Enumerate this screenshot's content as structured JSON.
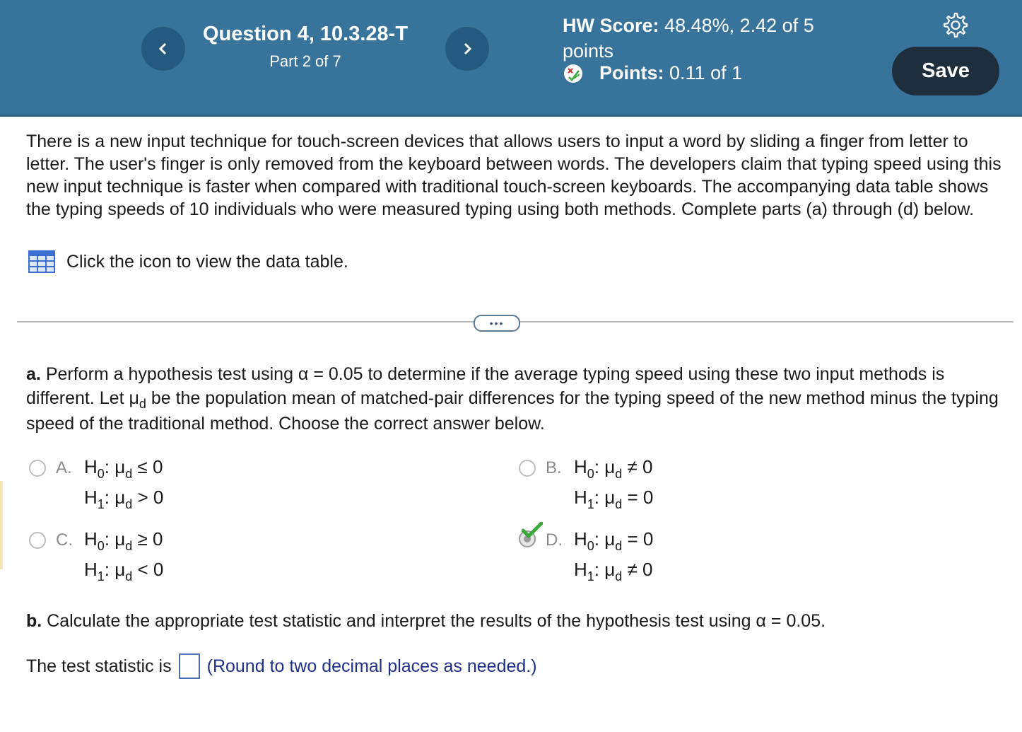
{
  "header": {
    "question_title": "Question 4, 10.3.28-T",
    "part": "Part 2 of 7",
    "hw_score_label": "HW Score:",
    "hw_score_value": "48.48%, 2.42 of 5",
    "hw_score_unit": "points",
    "points_label": "Points:",
    "points_value": "0.11 of 1",
    "save_label": "Save"
  },
  "problem": {
    "text": "There is a new input technique for touch-screen devices that allows users to input a word by sliding a finger from letter to letter. The user's finger is only removed from the keyboard between words. The developers claim that typing speed using this new input technique is faster when compared with traditional touch-screen keyboards. The accompanying data table shows the typing speeds of 10 individuals who were measured typing using both methods. Complete parts (a) through (d) below.",
    "data_link": "Click the icon to view the data table."
  },
  "divider_more": "•••",
  "part_a": {
    "label": "a.",
    "text_1": "Perform a hypothesis test using α = 0.05 to determine if the average typing speed using these two input methods is different. Let μ",
    "sub": "d",
    "text_2": " be the population mean of matched-pair differences for the typing speed of the new method minus the typing speed of the traditional method. Choose the correct answer below.",
    "options": [
      {
        "letter": "A.",
        "h0": "H",
        "h0_sub": "0",
        "h0_rel": ": μ",
        "h0_rel_sub": "d",
        "h0_tail": " ≤ 0",
        "h1": "H",
        "h1_sub": "1",
        "h1_rel": ": μ",
        "h1_rel_sub": "d",
        "h1_tail": " > 0"
      },
      {
        "letter": "B.",
        "h0": "H",
        "h0_sub": "0",
        "h0_rel": ": μ",
        "h0_rel_sub": "d",
        "h0_tail": " ≠ 0",
        "h1": "H",
        "h1_sub": "1",
        "h1_rel": ": μ",
        "h1_rel_sub": "d",
        "h1_tail": " = 0"
      },
      {
        "letter": "C.",
        "h0": "H",
        "h0_sub": "0",
        "h0_rel": ": μ",
        "h0_rel_sub": "d",
        "h0_tail": " ≥ 0",
        "h1": "H",
        "h1_sub": "1",
        "h1_rel": ": μ",
        "h1_rel_sub": "d",
        "h1_tail": " < 0"
      },
      {
        "letter": "D.",
        "h0": "H",
        "h0_sub": "0",
        "h0_rel": ": μ",
        "h0_rel_sub": "d",
        "h0_tail": " = 0",
        "h1": "H",
        "h1_sub": "1",
        "h1_rel": ": μ",
        "h1_rel_sub": "d",
        "h1_tail": " ≠ 0",
        "selected": true,
        "correct": true
      }
    ]
  },
  "part_b": {
    "label": "b.",
    "text": "Calculate the appropriate test statistic and interpret the results of the hypothesis test using α = 0.05.",
    "ts_label": "The test statistic is",
    "ts_value": "",
    "ts_hint": "(Round to two decimal places as needed.)"
  },
  "colors": {
    "header_bg": "#37739a",
    "nav_btn": "#245a7e",
    "save_btn": "#1e2e3c",
    "hint_text": "#1d2f8a",
    "correct_check": "#3aa83a"
  },
  "icons": [
    "chevron-left-icon",
    "chevron-right-icon",
    "points-status-icon",
    "gear-icon",
    "data-table-icon",
    "check-icon"
  ]
}
